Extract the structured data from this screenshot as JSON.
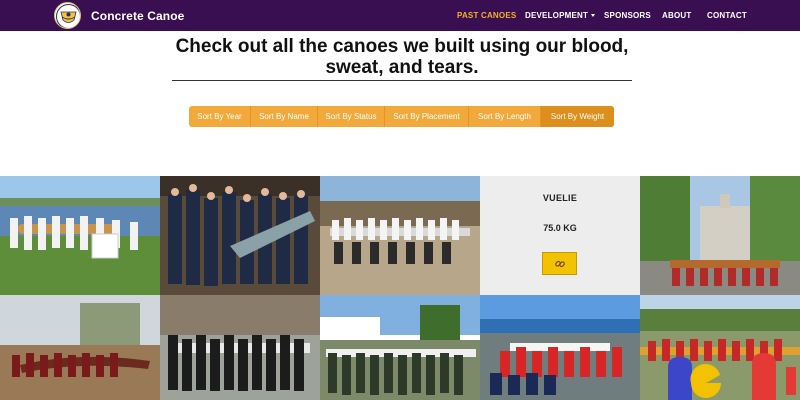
{
  "brand": {
    "name": "Concrete Canoe",
    "logo_icon": "team-crest-logo"
  },
  "nav": {
    "past_canoes": "PAST CANOES",
    "development": "DEVELOPMENT",
    "sponsors": "SPONSORS",
    "about": "ABOUT",
    "contact": "CONTACT"
  },
  "heading": {
    "line1": "Check out all the canoes we built using our blood,",
    "line2": "sweat, and tears."
  },
  "sort": {
    "year": "Sort By Year",
    "name": "Sort By Name",
    "status": "Sort By Status",
    "placement": "Sort By Placement",
    "length": "Sort By Length",
    "weight": "Sort By Weight",
    "active": "weight"
  },
  "featured": {
    "name": "VUELIE",
    "weight": "75.0 KG",
    "link_icon": "link-icon"
  },
  "colors": {
    "nav_bg": "#3a0f52",
    "accent": "#f4b02a",
    "sort_bg": "#f2a93b",
    "link_button": "#f2c200"
  }
}
